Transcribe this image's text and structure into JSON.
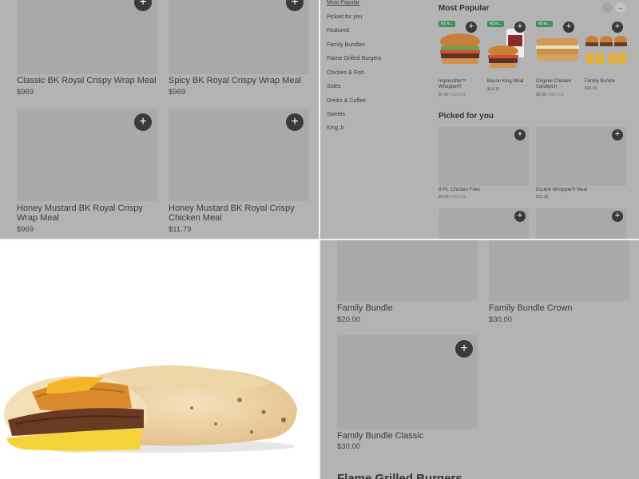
{
  "panel1": {
    "items": [
      {
        "name": "Classic BK Royal Crispy Wrap Meal",
        "price": "$969"
      },
      {
        "name": "Spicy BK Royal Crispy Wrap  Meal",
        "price": "$969"
      },
      {
        "name": "Honey Mustard BK Royal Crispy Wrap Meal",
        "price": "$969"
      },
      {
        "name": "Honey Mustard BK Royal Crispy Chicken Meal",
        "price": "$11.79"
      }
    ],
    "add_label": "+"
  },
  "panel2": {
    "nav": [
      "Most Popular",
      "Picked for you",
      "Featured",
      "Family Bundles",
      "Flame Grilled Burgers",
      "Chicken & Fish",
      "Sides",
      "Drinks & Coffee",
      "Sweets",
      "King Jr"
    ],
    "most_popular_title": "Most Popular",
    "arrows": {
      "prev": "←",
      "next": "→"
    },
    "popular": [
      {
        "tag": "#1 m...",
        "name": "Impossible™ Whopper®",
        "price": "$7.69",
        "cal": " • 629 Cal"
      },
      {
        "tag": "#2 m...",
        "name": "Bacon King Meal",
        "price": "$14.19",
        "cal": ""
      },
      {
        "tag": "#3 m...",
        "name": "Original Chicken Sandwich",
        "price": "$5.99",
        "cal": " • 662 Cal"
      },
      {
        "tag": "",
        "name": "Family Bundle",
        "price": "$20.00",
        "cal": ""
      }
    ],
    "picked_title": "Picked for you",
    "picked": [
      {
        "name": "9 Pc. Chicken Fries",
        "price": "$4.59",
        "cal": " • 430 Cal"
      },
      {
        "name": "Double Whopper® Meal",
        "price": "$13.39",
        "cal": ""
      }
    ],
    "add_label": "+"
  },
  "panel4": {
    "items": [
      {
        "name": "Family Bundle",
        "price": "$20.00"
      },
      {
        "name": "Family Bundle Crown",
        "price": "$30.00"
      },
      {
        "name": "Family Bundle Classic",
        "price": "$30.00"
      }
    ],
    "section_title": "Flame Grilled Burgers",
    "add_label": "+"
  }
}
